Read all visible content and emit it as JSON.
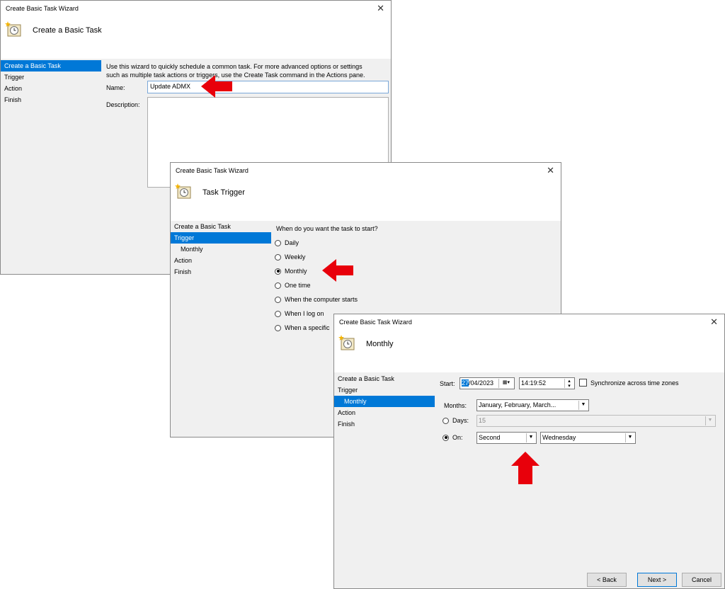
{
  "icons": {
    "task": "scheduled-task-clock-icon",
    "close": "close-icon",
    "arrow": "red-arrow-icon"
  },
  "colors": {
    "selection": "#0078d7",
    "arrow": "#e8000b"
  },
  "w1": {
    "title": "Create Basic Task Wizard",
    "close": "✕",
    "header": "Create a Basic Task",
    "nav": [
      "Create a Basic Task",
      "Trigger",
      "Action",
      "Finish"
    ],
    "intro_line1": "Use this wizard to quickly schedule a common task.  For more advanced options or settings",
    "intro_line2": "such as multiple task actions or triggers, use the Create Task command in the Actions pane.",
    "name_label": "Name:",
    "name_value": "Update ADMX",
    "desc_label": "Description:"
  },
  "w2": {
    "title": "Create Basic Task Wizard",
    "close": "✕",
    "header": "Task Trigger",
    "nav": [
      "Create a Basic Task",
      "Trigger",
      "Monthly",
      "Action",
      "Finish"
    ],
    "question": "When do you want the task to start?",
    "options": [
      "Daily",
      "Weekly",
      "Monthly",
      "One time",
      "When the computer starts",
      "When I log on",
      "When a specific"
    ],
    "selected": "Monthly"
  },
  "w3": {
    "title": "Create Basic Task Wizard",
    "close": "✕",
    "header": "Monthly",
    "nav": [
      "Create a Basic Task",
      "Trigger",
      "Monthly",
      "Action",
      "Finish"
    ],
    "start_label": "Start:",
    "start_date_sel": "27",
    "start_date_rest": "/04/2023",
    "start_time": "14:19:52",
    "sync_label": "Synchronize across time zones",
    "months_label": "Months:",
    "months_value": "January, February, March...",
    "days_label": "Days:",
    "days_value": "15",
    "on_label": "On:",
    "on_week": "Second",
    "on_day": "Wednesday",
    "back": "< Back",
    "next": "Next >",
    "cancel": "Cancel"
  }
}
